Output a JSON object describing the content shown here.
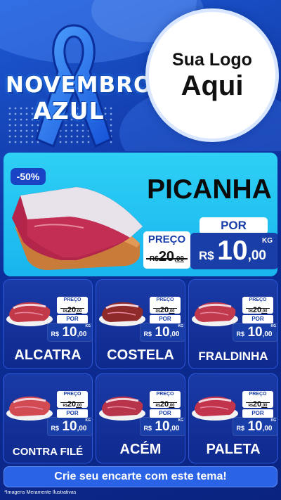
{
  "header": {
    "campaign_line1": "NOVEMBRO",
    "campaign_line2": "AZUL",
    "logo_line1": "Sua Logo",
    "logo_line2": "Aqui"
  },
  "hero": {
    "discount": "-50%",
    "name": "PICANHA",
    "por_label": "POR",
    "preco_label": "PREÇO",
    "old_currency": "R$",
    "old_int": "20",
    "old_dec": ",00",
    "currency": "R$",
    "price_int": "10",
    "price_dec": ",00",
    "unit": "KG"
  },
  "products": [
    {
      "name": "ALCATRA",
      "preco_label": "PREÇO",
      "old_currency": "R$",
      "old_int": "20",
      "old_dec": ",00",
      "por_label": "POR",
      "currency": "R$",
      "price_int": "10",
      "price_dec": ",00",
      "unit": "KG"
    },
    {
      "name": "COSTELA",
      "preco_label": "PREÇO",
      "old_currency": "R$",
      "old_int": "20",
      "old_dec": ",00",
      "por_label": "POR",
      "currency": "R$",
      "price_int": "10",
      "price_dec": ",00",
      "unit": "KG"
    },
    {
      "name": "FRALDINHA",
      "preco_label": "PREÇO",
      "old_currency": "R$",
      "old_int": "20",
      "old_dec": ",00",
      "por_label": "POR",
      "currency": "R$",
      "price_int": "10",
      "price_dec": ",00",
      "unit": "KG"
    },
    {
      "name": "CONTRA FILÉ",
      "preco_label": "PREÇO",
      "old_currency": "R$",
      "old_int": "20",
      "old_dec": ",00",
      "por_label": "POR",
      "currency": "R$",
      "price_int": "10",
      "price_dec": ",00",
      "unit": "KG"
    },
    {
      "name": "ACÉM",
      "preco_label": "PREÇO",
      "old_currency": "R$",
      "old_int": "20",
      "old_dec": ",00",
      "por_label": "POR",
      "currency": "R$",
      "price_int": "10",
      "price_dec": ",00",
      "unit": "KG"
    },
    {
      "name": "PALETA",
      "preco_label": "PREÇO",
      "old_currency": "R$",
      "old_int": "20",
      "old_dec": ",00",
      "por_label": "POR",
      "currency": "R$",
      "price_int": "10",
      "price_dec": ",00",
      "unit": "KG"
    }
  ],
  "footer": {
    "cta": "Crie seu encarte com este tema!",
    "disclaimer": "*Imagens Meramente Ilustrativas"
  },
  "colors": {
    "background": "#0d2f9a",
    "hero_background": "#18b5ee",
    "price_box": "#1a3ea8",
    "cta": "#2b63e6",
    "ribbon": "#2a7df5"
  },
  "icons": {
    "ribbon": "awareness-ribbon-icon",
    "hero_image": "picanha-meat-cut",
    "product_image": "meat-cut"
  }
}
